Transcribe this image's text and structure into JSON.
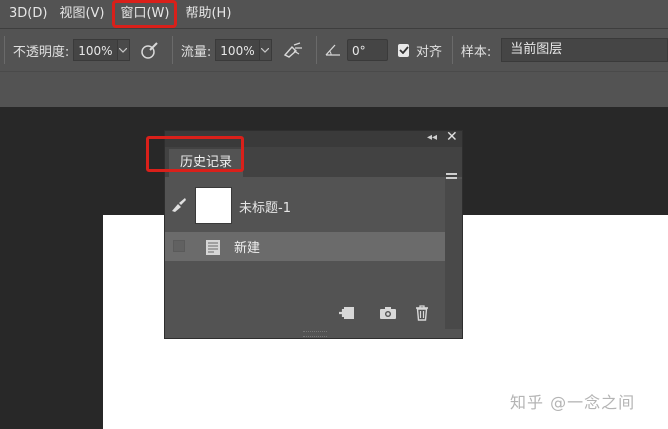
{
  "menubar": {
    "items": [
      {
        "label": "3D(D)",
        "highlighted": false
      },
      {
        "label": "视图(V)",
        "highlighted": false
      },
      {
        "label": "窗口(W)",
        "highlighted": true
      },
      {
        "label": "帮助(H)",
        "highlighted": false
      }
    ]
  },
  "options": {
    "opacity_label": "不透明度:",
    "opacity_value": "100%",
    "flow_label": "流量:",
    "flow_value": "100%",
    "angle_value": "0°",
    "align_label": "对齐",
    "align_checked": true,
    "sample_label": "样本:",
    "sample_value": "当前图层"
  },
  "history_panel": {
    "tab_label": "历史记录",
    "snapshot_label": "未标题-1",
    "steps": [
      {
        "label": "新建",
        "icon": "document-icon"
      }
    ],
    "footer_icons": [
      "new-document-from-state-icon",
      "camera-icon",
      "trash-icon"
    ]
  },
  "watermark": "知乎 @一念之间",
  "colors": {
    "chrome": "#535353",
    "workspace": "#282828",
    "highlight_border": "#d9201a",
    "selected_row": "#6b6b6b"
  }
}
